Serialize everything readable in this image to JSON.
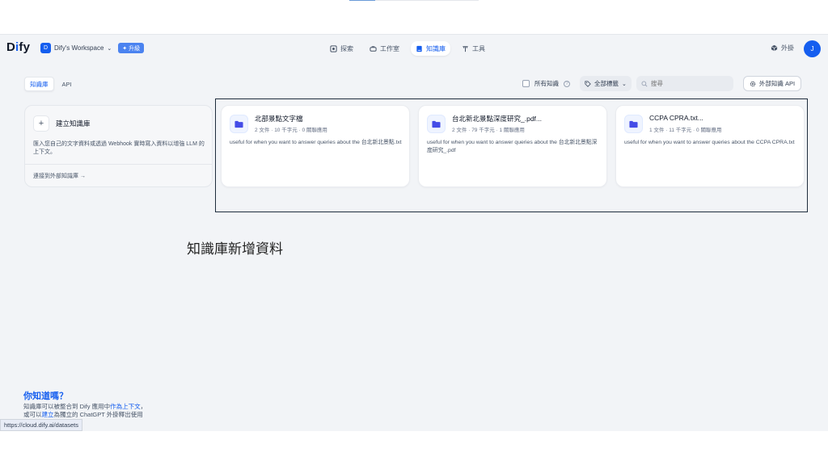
{
  "header": {
    "logo_main": "D",
    "logo_accent": "i",
    "logo_rest": "fy",
    "workspace_initial": "D",
    "workspace_name": "Dify's Workspace",
    "upgrade_label": "✦ 升級",
    "nav": [
      {
        "label": "探索",
        "icon": "explore-icon",
        "active": false
      },
      {
        "label": "工作室",
        "icon": "studio-icon",
        "active": false
      },
      {
        "label": "知識庫",
        "icon": "knowledge-icon",
        "active": true
      },
      {
        "label": "工具",
        "icon": "tools-icon",
        "active": false
      }
    ],
    "explore_label": "外掛",
    "user_initial": "J"
  },
  "tabs": [
    {
      "label": "知識庫",
      "active": true
    },
    {
      "label": "API",
      "active": false
    }
  ],
  "filters": {
    "all_knowledge_label": "所有知識",
    "all_tags_label": "全部標籤",
    "search_placeholder": "搜尋",
    "external_api_label": "外部知識 API"
  },
  "create_card": {
    "title": "建立知識庫",
    "description": "匯入您自己的文字資料或透過 Webhook 實時寫入資料以增強 LLM 的上下文。",
    "connect_external": "連接到外部知識庫 →"
  },
  "datasets": [
    {
      "name": "北部景點文字檔",
      "meta": "2 文件 · 10 千字元 · 0 關聯應用",
      "description": "useful for when you want to answer queries about the 台北新北景點.txt"
    },
    {
      "name": "台北新北景點深度研究_.pdf...",
      "meta": "2 文件 · 79 千字元 · 1 關聯應用",
      "description": "useful for when you want to answer queries about the 台北新北景點深度研究_.pdf"
    },
    {
      "name": "CCPA CPRA.txt...",
      "meta": "1 文件 · 11 千字元 · 0 關聯應用",
      "description": "useful for when you want to answer queries about the CCPA CPRA.txt"
    }
  ],
  "annotation": "知識庫新增資料",
  "did_you_know": {
    "title": "你知道嗎？",
    "line1_prefix": "知識庫可以被整合到 Dify 應用中",
    "line1_link": "作為上下文",
    "line1_suffix": "，",
    "line2_prefix": "或可以",
    "line2_link": "建立",
    "line2_suffix": "為獨立的 ChatGPT 外掛釋出使用"
  },
  "status_url": "https://cloud.dify.ai/datasets",
  "colors": {
    "accent": "#155eef",
    "background": "#f2f4f7"
  }
}
